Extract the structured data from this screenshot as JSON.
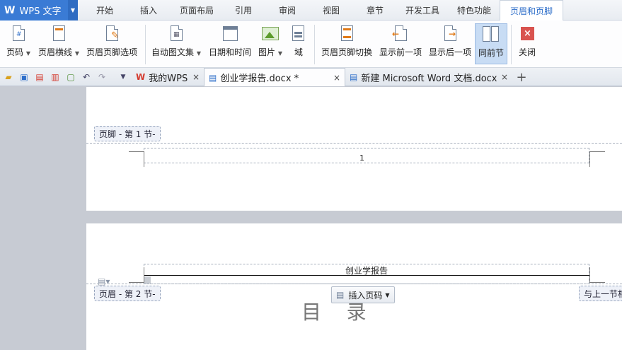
{
  "app": {
    "logo": "W",
    "name": "WPS 文字"
  },
  "menu_tabs": [
    "开始",
    "插入",
    "页面布局",
    "引用",
    "审阅",
    "视图",
    "章节",
    "开发工具",
    "特色功能",
    "页眉和页脚"
  ],
  "ribbon": {
    "page_num": "页码",
    "header_line": "页眉横线",
    "hf_options": "页眉页脚选项",
    "auto_text": "自动图文集",
    "datetime": "日期和时间",
    "picture": "图片",
    "field": "域",
    "hf_switch": "页眉页脚切换",
    "show_prev": "显示前一项",
    "show_next": "显示后一项",
    "same_as_prev": "同前节",
    "close": "关闭"
  },
  "tabs": {
    "my_wps": "我的WPS",
    "doc1": "创业学报告.docx *",
    "doc2": "新建 Microsoft Word 文档.docx",
    "close_glyph": "×",
    "add_glyph": "+"
  },
  "page1": {
    "footer_tag": "页脚  - 第 1 节-",
    "footer_text": "1"
  },
  "page2": {
    "header_text": "创业学报告",
    "header_tag": "页眉  - 第 2 节-",
    "insert_page_num": "插入页码",
    "link_prev": "与上一节相",
    "heading": "目    录"
  }
}
